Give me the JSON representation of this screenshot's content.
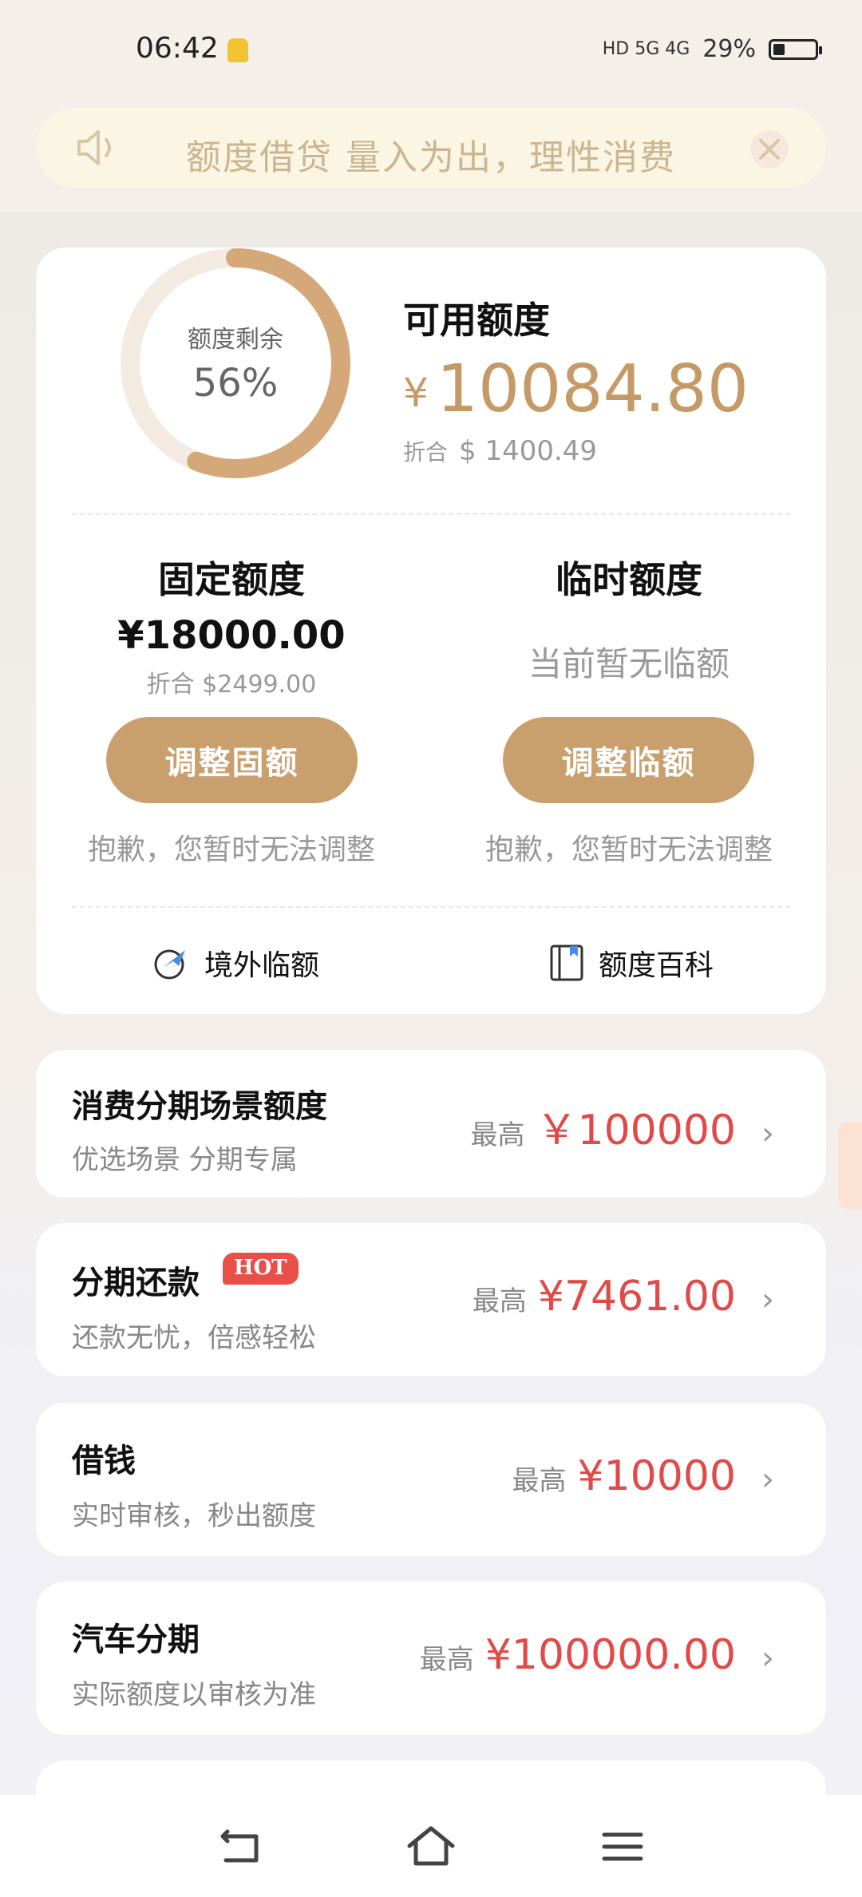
{
  "status_bar": {
    "time": "06:42",
    "network": "HD 5G 4G",
    "battery_percent": "29%",
    "battery_level": 0.29
  },
  "notice": {
    "text": "额度借贷 量入为出，理性消费"
  },
  "quota": {
    "ring_label": "额度剩余",
    "ring_value": "56%",
    "ring_fraction": 0.56,
    "available_title": "可用额度",
    "currency_symbol": "¥",
    "available_amount": "10084.80",
    "equiv_prefix": "折合",
    "available_equiv": "$ 1400.49",
    "fixed": {
      "title": "固定额度",
      "amount": "¥18000.00",
      "equiv": "折合 $2499.00",
      "button": "调整固额",
      "note": "抱歉，您暂时无法调整"
    },
    "temp": {
      "title": "临时额度",
      "empty": "当前暂无临额",
      "button": "调整临额",
      "note": "抱歉，您暂时无法调整"
    },
    "links": {
      "overseas": "境外临额",
      "wiki": "额度百科"
    }
  },
  "rows": [
    {
      "title": "消费分期场景额度",
      "subtitle": "优选场景 分期专属",
      "prefix": "最高",
      "amount": "￥100000"
    },
    {
      "title": "分期还款",
      "badge": "HOT",
      "subtitle": "还款无忧，倍感轻松",
      "prefix": "最高",
      "amount": "¥7461.00"
    },
    {
      "title": "借钱",
      "subtitle": "实时审核，秒出额度",
      "prefix": "最高",
      "amount": "¥10000"
    },
    {
      "title": "汽车分期",
      "subtitle": "实际额度以审核为准",
      "prefix": "最高",
      "amount": "¥100000.00"
    }
  ],
  "colors": {
    "accent": "#c99f6e",
    "amount_red": "#e04a48",
    "ring_track": "#f3ebe2"
  },
  "nav_icons": [
    "back-icon",
    "home-icon",
    "menu-icon"
  ]
}
